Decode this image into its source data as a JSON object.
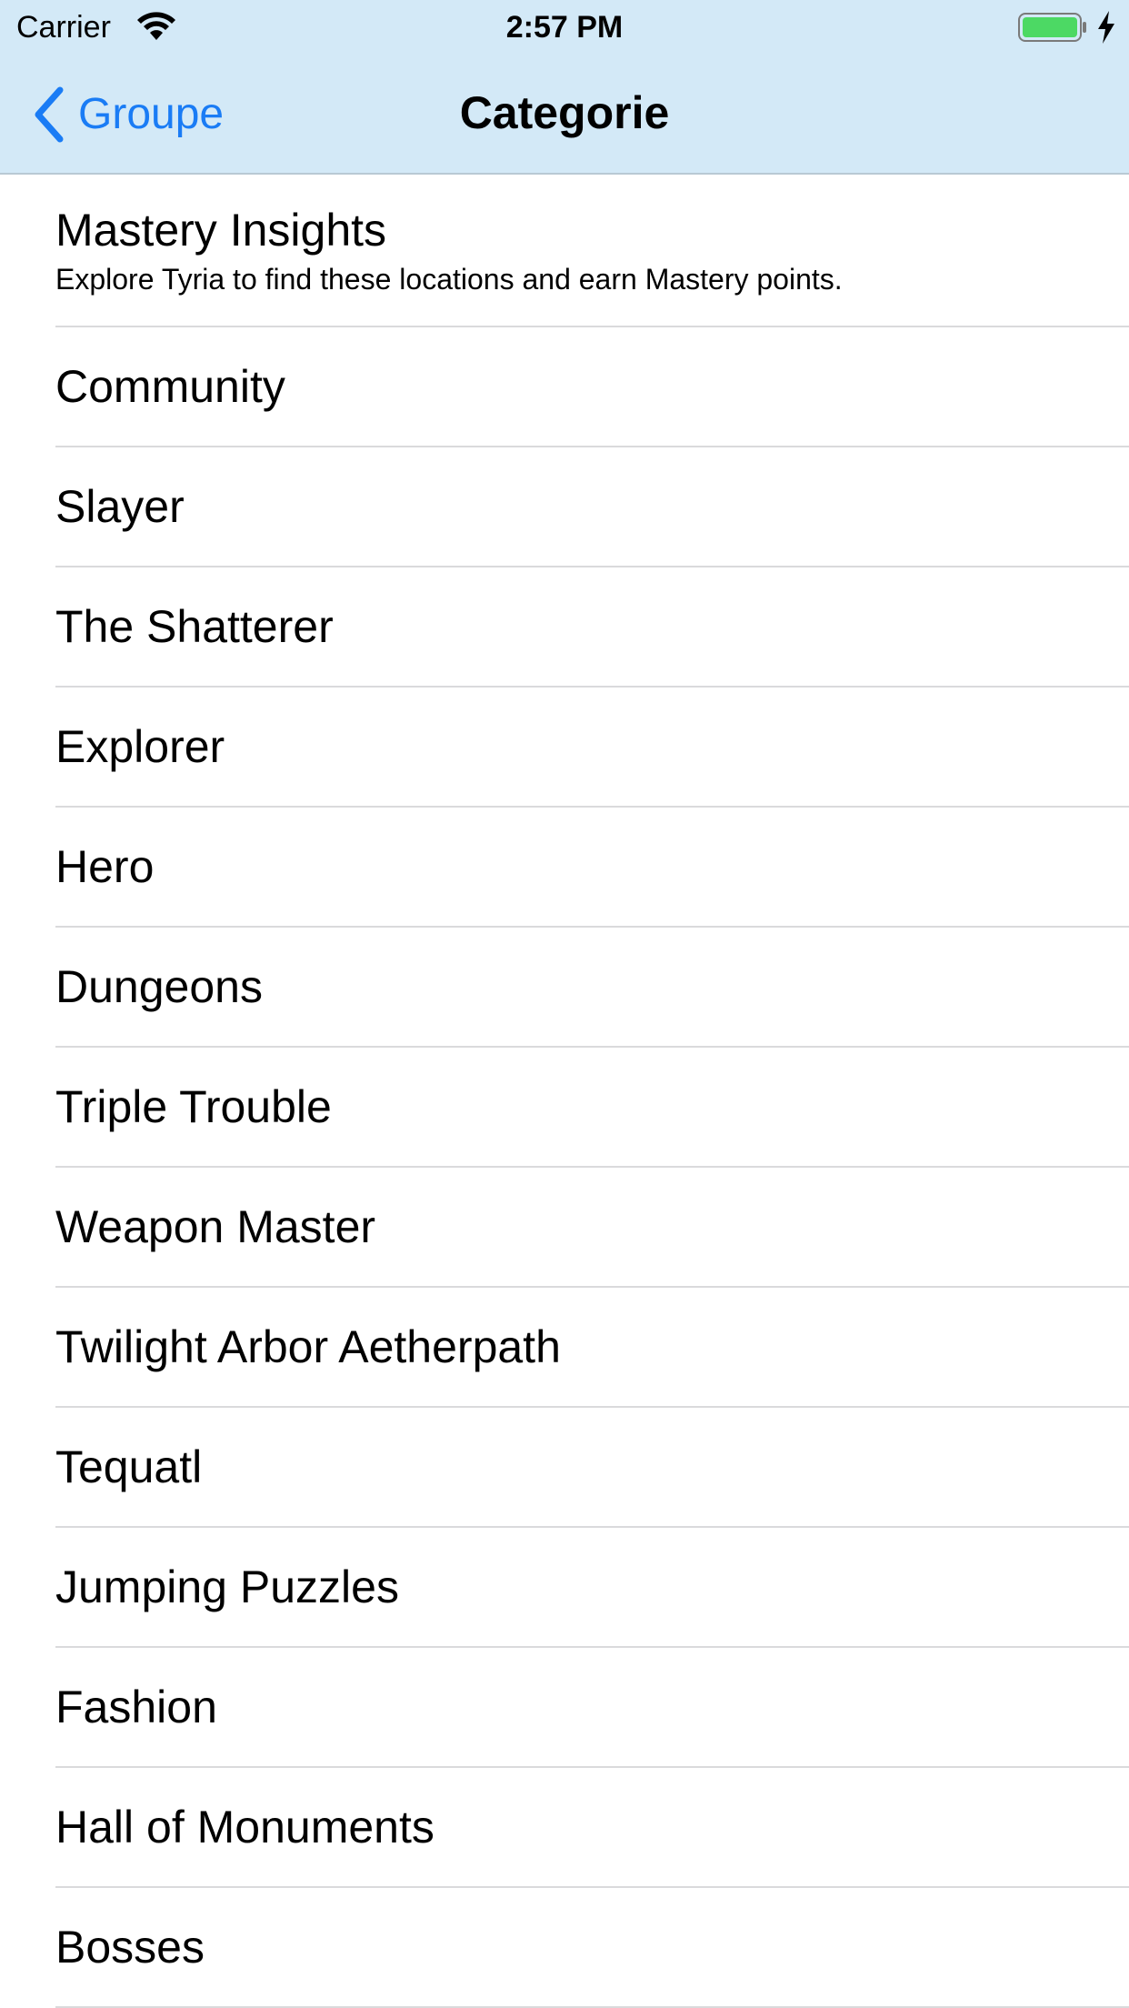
{
  "status_bar": {
    "carrier": "Carrier",
    "time": "2:57 PM",
    "wifi_icon": "wifi-icon",
    "battery_icon": "battery-icon",
    "charging_icon": "charging-bolt-icon",
    "battery_color": "#4cd964"
  },
  "navbar": {
    "back_label": "Groupe",
    "back_icon": "chevron-left-icon",
    "title": "Categorie",
    "background": "#d3e9f7",
    "accent": "#1a7cf5"
  },
  "list": {
    "featured": {
      "title": "Mastery Insights",
      "subtitle": "Explore Tyria to find these locations and earn Mastery points."
    },
    "items": [
      "Community",
      "Slayer",
      "The Shatterer",
      "Explorer",
      "Hero",
      "Dungeons",
      "Triple Trouble",
      "Weapon Master",
      "Twilight Arbor Aetherpath",
      "Tequatl",
      "Jumping Puzzles",
      "Fashion",
      "Hall of Monuments",
      "Bosses"
    ]
  }
}
